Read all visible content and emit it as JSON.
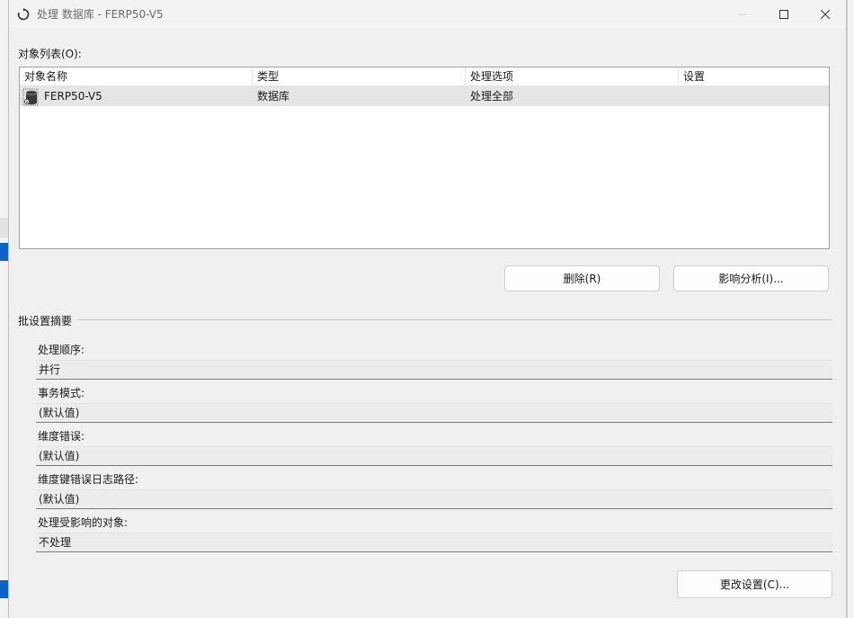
{
  "window": {
    "title": "处理 数据库 - FERP50-V5"
  },
  "object_list": {
    "label": "对象列表(O):",
    "columns": [
      "对象名称",
      "类型",
      "处理选项",
      "设置"
    ],
    "rows": [
      {
        "name": "FERP50-V5",
        "type": "数据库",
        "option": "处理全部",
        "settings": ""
      }
    ]
  },
  "buttons": {
    "delete": "删除(R)",
    "impact": "影响分析(I)...",
    "change_settings": "更改设置(C)..."
  },
  "batch_summary": {
    "title": "批设置摘要",
    "fields": [
      {
        "label": "处理顺序:",
        "value": "并行"
      },
      {
        "label": "事务模式:",
        "value": "(默认值)"
      },
      {
        "label": "维度错误:",
        "value": "(默认值)"
      },
      {
        "label": "维度键错误日志路径:",
        "value": "(默认值)"
      },
      {
        "label": "处理受影响的对象:",
        "value": "不处理"
      }
    ]
  },
  "colors": {
    "window_bg": "#f0f0f0",
    "selected_row": "#e5e5e5",
    "accent": "#0a64c8"
  }
}
